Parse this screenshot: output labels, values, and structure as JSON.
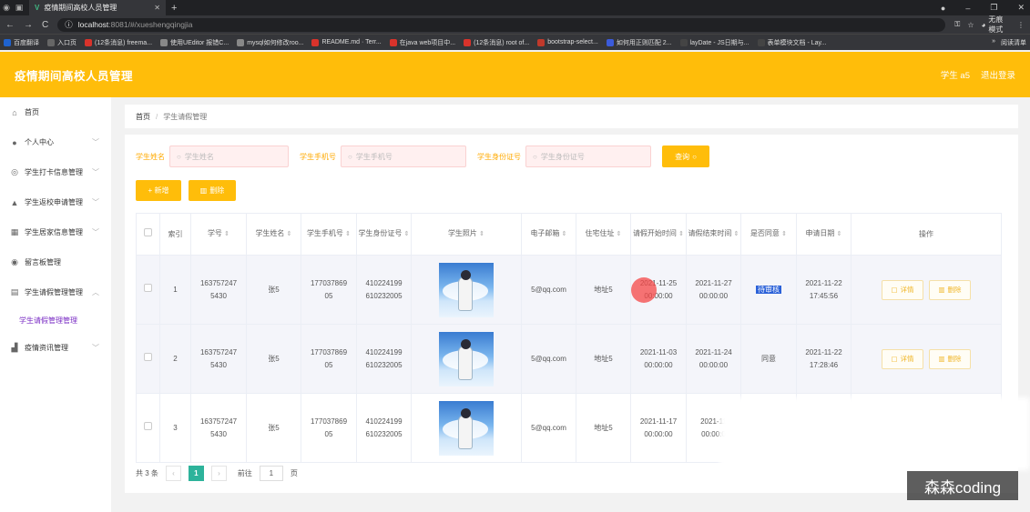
{
  "browser": {
    "tab_title": "疫情期间高校人员管理",
    "url_host": "localhost",
    "url_path": ":8081/#/xueshengqingjia",
    "incognito_label": "无痕模式",
    "bookmarks": [
      "百度翻译",
      "入口页",
      "(12条消息) freema...",
      "使用UEditor 报错C...",
      "mysql如何修改roo...",
      "README.md · Terr...",
      "在java web项目中...",
      "(12条消息) root of...",
      "bootstrap-select...",
      "如何用正则匹配 2...",
      "layDate - JS日期与...",
      "表单模块文档 - Lay..."
    ],
    "bookmarks_more": "»",
    "reading_list": "阅读清单"
  },
  "header": {
    "title": "疫情期间高校人员管理",
    "user": "学生 a5",
    "logout": "退出登录"
  },
  "sidebar": {
    "items": [
      {
        "label": "首页",
        "icon": "home-icon",
        "glyph": "⌂",
        "chev": false
      },
      {
        "label": "个人中心",
        "icon": "user-icon",
        "glyph": "●",
        "chev": true
      },
      {
        "label": "学生打卡信息管理",
        "icon": "clock-icon",
        "glyph": "◎",
        "chev": true
      },
      {
        "label": "学生返校申请管理",
        "icon": "bank-icon",
        "glyph": "▲",
        "chev": true
      },
      {
        "label": "学生居家信息管理",
        "icon": "list-icon",
        "glyph": "▦",
        "chev": true
      },
      {
        "label": "留言板管理",
        "icon": "location-icon",
        "glyph": "◉",
        "chev": false
      },
      {
        "label": "学生请假管理管理",
        "icon": "clipboard-icon",
        "glyph": "▤",
        "chev": true
      },
      {
        "label": "学生请假管理管理",
        "sub": true
      },
      {
        "label": "疫情资讯管理",
        "icon": "chart-icon",
        "glyph": "▟",
        "chev": true
      }
    ]
  },
  "breadcrumb": {
    "home": "首页",
    "sep": "/",
    "current": "学生请假管理"
  },
  "search": {
    "name_label": "学生姓名",
    "name_placeholder": "学生姓名",
    "phone_label": "学生手机号",
    "phone_placeholder": "学生手机号",
    "id_label": "学生身份证号",
    "id_placeholder": "学生身份证号",
    "query_button": "查询"
  },
  "actions": {
    "add": "+ 新增",
    "delete": "删除"
  },
  "table": {
    "headers": [
      "索引",
      "学号",
      "学生姓名",
      "学生手机号",
      "学生身份证号",
      "学生照片",
      "电子邮箱",
      "住宅住址",
      "请假开始时间",
      "请假结束时间",
      "是否同意",
      "申请日期",
      "操作"
    ],
    "rows": [
      {
        "index": "1",
        "xuehao": [
          "163757247",
          "5430"
        ],
        "name": "张5",
        "phone": [
          "177037869",
          "05"
        ],
        "idcard": [
          "410224199",
          "610232005"
        ],
        "email": "5@qq.com",
        "address": "地址5",
        "start": [
          "2021-11-25",
          "00:00:00"
        ],
        "end": [
          "2021-11-27",
          "00:00:00"
        ],
        "agree": "待审核",
        "date": [
          "2021-11-22",
          "17:45:56"
        ]
      },
      {
        "index": "2",
        "xuehao": [
          "163757247",
          "5430"
        ],
        "name": "张5",
        "phone": [
          "177037869",
          "05"
        ],
        "idcard": [
          "410224199",
          "610232005"
        ],
        "email": "5@qq.com",
        "address": "地址5",
        "start": [
          "2021-11-03",
          "00:00:00"
        ],
        "end": [
          "2021-11-24",
          "00:00:00"
        ],
        "agree": "同意",
        "date": [
          "2021-11-22",
          "17:28:46"
        ]
      },
      {
        "index": "3",
        "xuehao": [
          "163757247",
          "5430"
        ],
        "name": "张5",
        "phone": [
          "177037869",
          "05"
        ],
        "idcard": [
          "410224199",
          "610232005"
        ],
        "email": "5@qq.com",
        "address": "地址5",
        "start": [
          "2021-11-17",
          "00:00:00"
        ],
        "end": [
          "2021-11",
          "00:00:0"
        ],
        "agree": "",
        "date": [
          "",
          ""
        ]
      }
    ],
    "detail": "详情",
    "delete": "删除"
  },
  "pager": {
    "total": "共 3 条",
    "prev": "‹",
    "current": "1",
    "next": "›",
    "goto": "前往",
    "page_value": "1",
    "page_unit": "页"
  },
  "watermark": "森森coding",
  "colors": {
    "primary": "#ffbd0a",
    "accent": "#7a2cc4",
    "pager": "#2db39b"
  }
}
